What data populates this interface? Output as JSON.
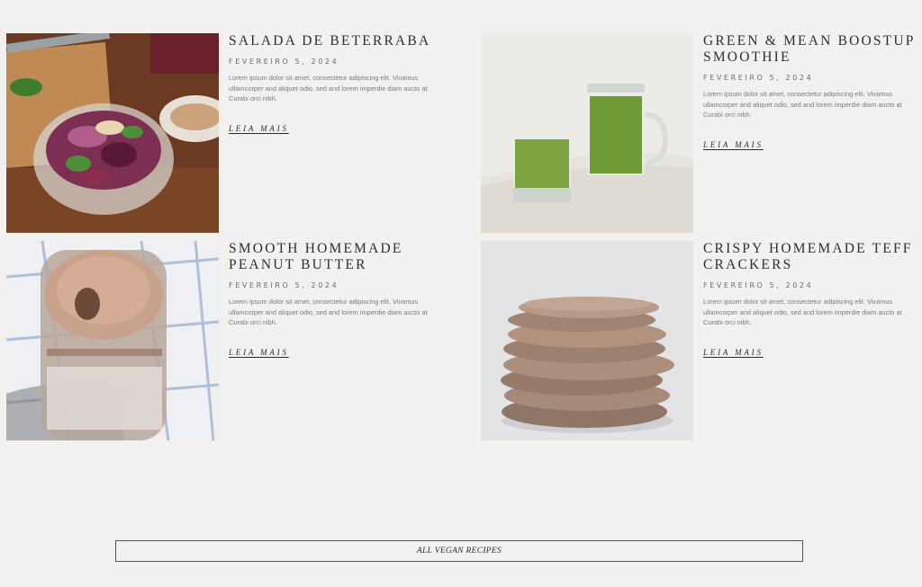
{
  "posts": [
    {
      "title": "Salada de Beterraba",
      "date": "Fevereiro 5, 2024",
      "excerpt": "Lorem ipsum dolor sit amet, consectetur adipiscing elit. Vivamus ullamcorper and aliquet odio, sed and lorem imperdie diam aucto at Curabi orci nibh.",
      "read_more": "Leia mais"
    },
    {
      "title": "Green & Mean Boostup Smoothie",
      "date": "Fevereiro 5, 2024",
      "excerpt": "Lorem ipsum dolor sit amet, consectetur adipiscing elit. Vivamus ullamcorper and aliquet odio, sed and lorem imperdie diam aucto at Curabi orci nibh.",
      "read_more": "Leia mais"
    },
    {
      "title": "Smooth Homemade Peanut Butter",
      "date": "Fevereiro 5, 2024",
      "excerpt": "Lorem ipsum dolor sit amet, consectetur adipiscing elit. Vivamus ullamcorper and aliquet odio, sed and lorem imperdie diam aucto at Curabi orci nibh.",
      "read_more": "Leia mais"
    },
    {
      "title": "Crispy Homemade Teff Crackers",
      "date": "Fevereiro 5, 2024",
      "excerpt": "Lorem ipsum dolor sit amet, consectetur adipiscing elit. Vivamus ullamcorper and aliquet odio, sed and lorem imperdie diam aucto at Curabi orci nibh.",
      "read_more": "Leia mais"
    }
  ],
  "cta": {
    "label": "ALL VEGAN RECIPES"
  },
  "colors": {
    "background": "#f3f1ef",
    "text": "#2e2e2e",
    "muted": "#7a7a7a"
  }
}
